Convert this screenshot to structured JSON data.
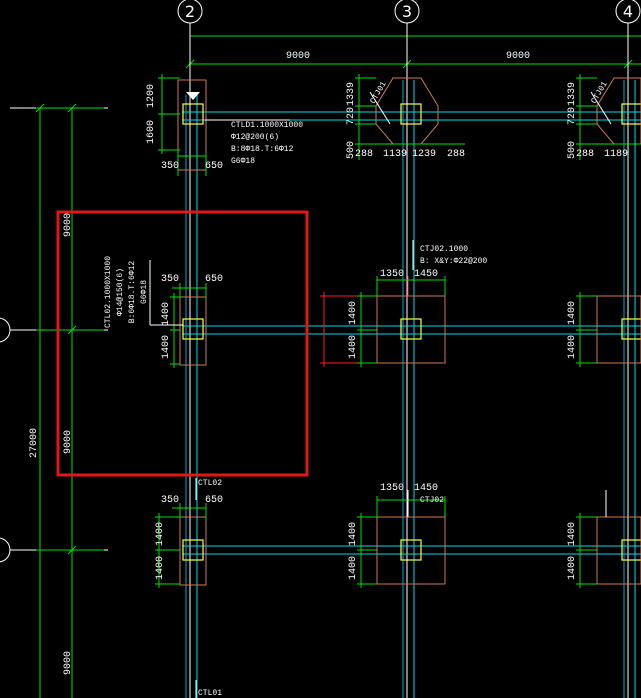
{
  "axes": {
    "top": [
      "2",
      "3",
      "4"
    ],
    "top_spans": [
      "9000",
      "9000"
    ],
    "left_total": "27000",
    "left_spans": [
      "9000",
      "9000",
      "9000"
    ]
  },
  "ctld1": {
    "dims_v": [
      "1200",
      "1600"
    ],
    "dims_h": [
      "350",
      "650"
    ],
    "label": "CTLD1.1000X1000",
    "lines": [
      "Φ12@200(6)",
      "B:8Φ18.T:6Φ12",
      "G6Φ18"
    ]
  },
  "ctj01": {
    "label": "CTJ01",
    "dims_v": [
      "1339",
      "720",
      "500"
    ],
    "dims_h": [
      "288",
      "1139",
      "1239",
      "288"
    ],
    "right_dims_h": [
      "288",
      "1189"
    ]
  },
  "ctl02_sel": {
    "dims_v_left": [
      "9000",
      "9000"
    ],
    "dims_h": [
      "350",
      "650"
    ],
    "dims_v": [
      "1400",
      "1400"
    ],
    "label": "CTL02.1000X1000",
    "lines": [
      "Φ14@150(6)",
      "B:6Φ18.T:6Φ12",
      "G6Φ18"
    ]
  },
  "ctj02_mid": {
    "label": "CTJ02.1000",
    "line": "B: X&Y:Φ22@200",
    "dims_h": [
      "1350",
      "1450"
    ],
    "dims_v": [
      "1400",
      "1400"
    ],
    "right_dims_v": [
      "1400",
      "1400"
    ]
  },
  "row3": {
    "left_label": "CTL02",
    "dims_h_left": [
      "350",
      "650"
    ],
    "dims_v_left": [
      "1400",
      "1400"
    ],
    "mid_label": "CTJ02",
    "dims_h_mid": [
      "1350",
      "1450"
    ],
    "dims_v_mid": [
      "1400",
      "1400"
    ],
    "dims_v_right": [
      "1400",
      "1400"
    ],
    "bottom_label": "CTL01"
  },
  "colors": {
    "background": "#000000",
    "grid": "#00e000",
    "beam": "#00d8e8",
    "column": "#ffff40",
    "foundation": "#d07850",
    "selection": "#e01818"
  }
}
